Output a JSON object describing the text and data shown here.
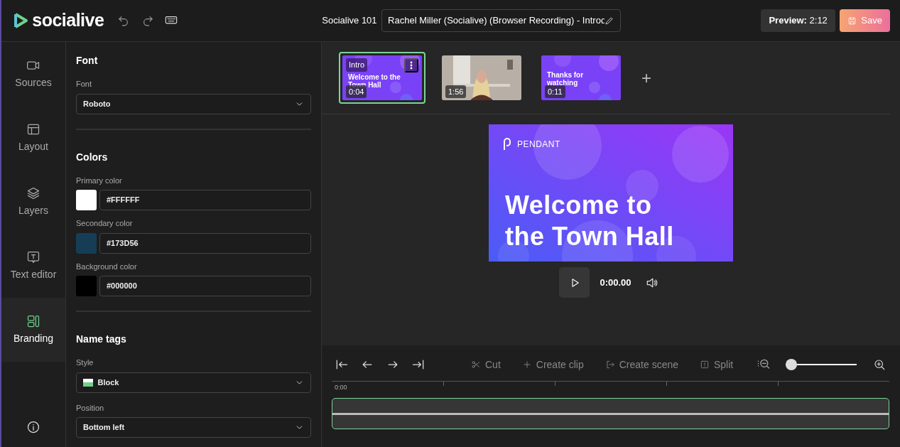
{
  "header": {
    "logo": "socialive",
    "project": "Socialive 101",
    "title_value": "Rachel Miller (Socialive) (Browser Recording) - Introd",
    "preview_label": "Preview:",
    "preview_time": "2:12",
    "save": "Save"
  },
  "sidebar": {
    "items": [
      {
        "label": "Sources",
        "kind": "camera",
        "selected": false
      },
      {
        "label": "Layout",
        "kind": "layout",
        "selected": false
      },
      {
        "label": "Layers",
        "kind": "layers",
        "selected": false
      },
      {
        "label": "Text editor",
        "kind": "text",
        "selected": false
      },
      {
        "label": "Branding",
        "kind": "branding",
        "selected": true
      }
    ]
  },
  "settings": {
    "sections": [
      {
        "title": "Font",
        "fields": [
          {
            "kind": "select",
            "label": "Font",
            "value": "Roboto"
          }
        ]
      },
      {
        "title": "Colors",
        "fields": [
          {
            "kind": "color",
            "label": "Primary color",
            "value": "#FFFFFF",
            "color": "#ffffff"
          },
          {
            "kind": "color",
            "label": "Secondary color",
            "value": "#173D56",
            "color": "#173d56"
          },
          {
            "kind": "color",
            "label": "Background color",
            "value": "#000000",
            "color": "#000000"
          }
        ]
      },
      {
        "title": "Name tags",
        "fields": [
          {
            "kind": "swatch_select",
            "label": "Style",
            "value": "Block"
          },
          {
            "kind": "select",
            "label": "Position",
            "value": "Bottom left"
          }
        ]
      }
    ]
  },
  "scenes": [
    {
      "kind": "slide",
      "tag": "Intro",
      "title": "Welcome to the Town Hall",
      "time": "0:04",
      "selected": true
    },
    {
      "kind": "video",
      "time": "1:56",
      "selected": false
    },
    {
      "kind": "slide",
      "title": "Thanks for watching",
      "time": "0:11",
      "selected": false
    }
  ],
  "add_scene": "+",
  "preview": {
    "logo": "PENDANT",
    "title_lines": [
      "Welcome to",
      "the Town Hall"
    ],
    "time": "0:00.00"
  },
  "toolbar": [
    {
      "kind": "first",
      "disabled": false
    },
    {
      "kind": "back",
      "disabled": false
    },
    {
      "kind": "forward",
      "disabled": false
    },
    {
      "kind": "last",
      "disabled": false
    },
    {
      "kind": "cut",
      "label": "Cut",
      "disabled": true
    },
    {
      "kind": "plus",
      "label": "Create clip",
      "disabled": true
    },
    {
      "kind": "scene",
      "label": "Create scene",
      "disabled": true
    },
    {
      "kind": "split",
      "label": "Split",
      "disabled": true
    }
  ],
  "zoom": {
    "level": 0.0
  },
  "ruler": {
    "start": "0:00"
  }
}
